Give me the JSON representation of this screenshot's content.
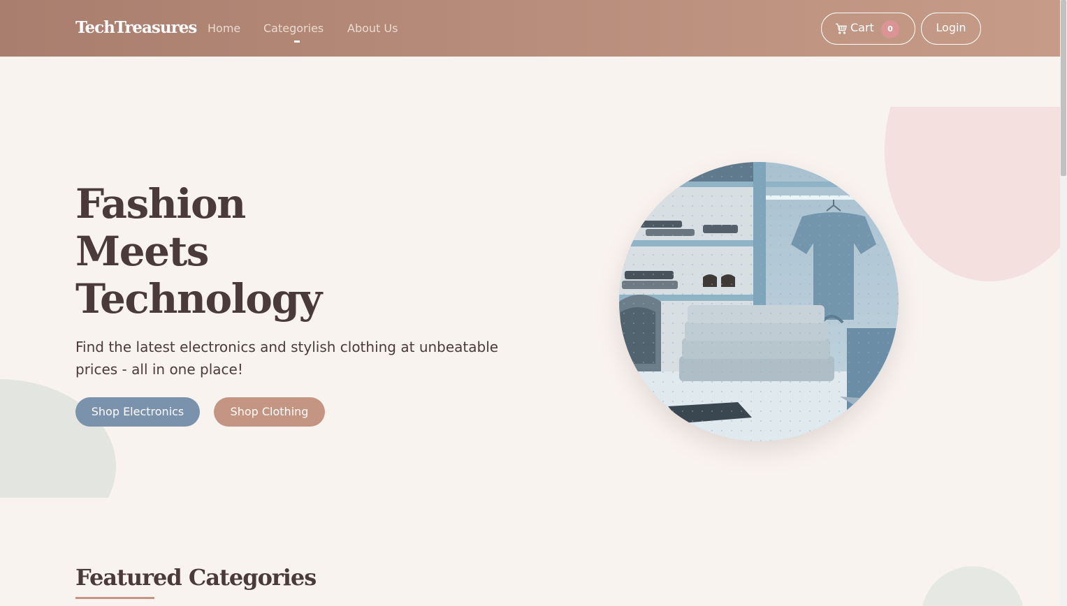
{
  "navbar": {
    "brand": "TechTreasures",
    "links": [
      "Home",
      "Categories",
      "About Us"
    ],
    "active_link": "Categories",
    "cart_label": "Cart",
    "cart_count": "0",
    "login_label": "Login"
  },
  "hero": {
    "title_lines": [
      "Fashion",
      "Meets",
      "Technology"
    ],
    "subtitle": "Find the latest electronics and stylish clothing at unbeatable prices - all in one place!",
    "buttons": [
      "Shop Electronics",
      "Shop Clothing"
    ]
  },
  "featured": {
    "title": "Featured Categories"
  },
  "colors": {
    "navbar_gradient_start": "#a97e6e",
    "navbar_gradient_end": "#c69c89",
    "page_background": "#f9f3f0",
    "heading_text": "#4a3b38",
    "electronics_button": "#7b92ad",
    "clothing_button": "#c39582",
    "cart_badge": "#d99493"
  },
  "icons": [
    "cart-icon"
  ]
}
